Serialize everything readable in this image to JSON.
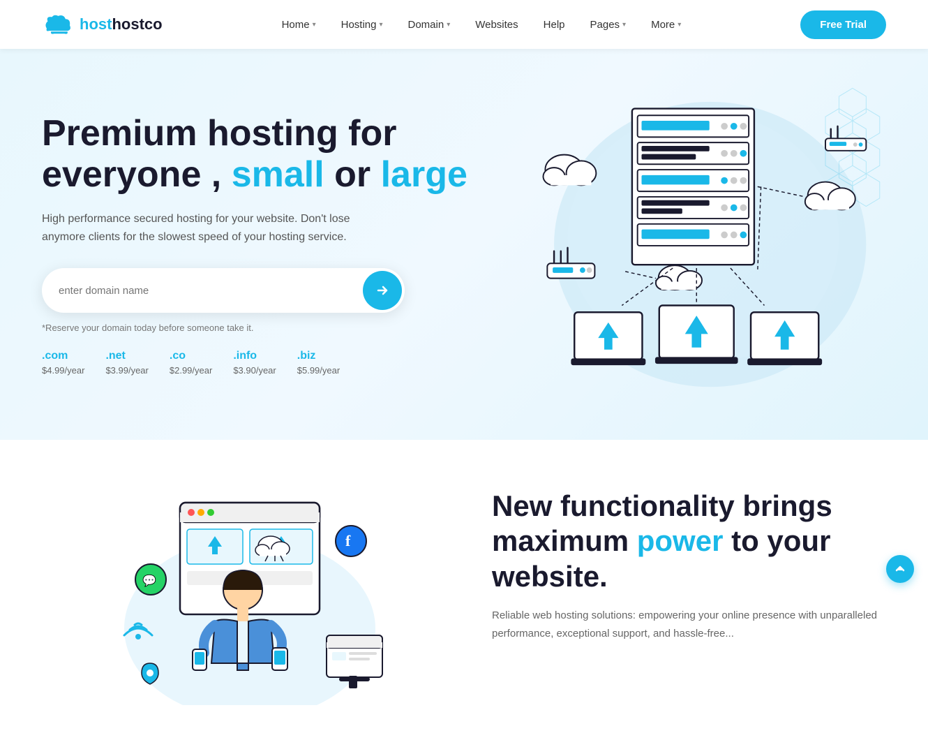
{
  "brand": {
    "name": "hostco",
    "logo_alt": "hostco logo"
  },
  "nav": {
    "links": [
      {
        "label": "Home",
        "has_dropdown": true
      },
      {
        "label": "Hosting",
        "has_dropdown": true
      },
      {
        "label": "Domain",
        "has_dropdown": true
      },
      {
        "label": "Websites",
        "has_dropdown": false
      },
      {
        "label": "Help",
        "has_dropdown": false
      },
      {
        "label": "Pages",
        "has_dropdown": true
      },
      {
        "label": "More",
        "has_dropdown": true
      }
    ],
    "cta_label": "Free Trial"
  },
  "hero": {
    "title_line1": "Premium hosting for",
    "title_line2_a": "everyone ,",
    "title_line2_b": "small",
    "title_line2_c": "or",
    "title_line2_d": "large",
    "subtitle": "High performance secured hosting for your website. Don't lose anymore clients for the slowest speed of your hosting service.",
    "search_placeholder": "enter domain name",
    "search_note": "*Reserve your domain today before someone take it.",
    "domains": [
      {
        "ext": ".com",
        "price": "$4.99/year"
      },
      {
        "ext": ".net",
        "price": "$3.99/year"
      },
      {
        "ext": ".co",
        "price": "$2.99/year"
      },
      {
        "ext": ".info",
        "price": "$3.90/year"
      },
      {
        "ext": ".biz",
        "price": "$5.99/year"
      }
    ]
  },
  "section2": {
    "title_a": "New functionality brings",
    "title_b": "maximum",
    "title_accent": "power",
    "title_c": "to your",
    "title_d": "website.",
    "text": "Reliable web hosting solutions: empowering your online presence with unparalleled performance, exceptional support, and hassle-free..."
  },
  "scroll_top": {
    "label": "↑"
  }
}
